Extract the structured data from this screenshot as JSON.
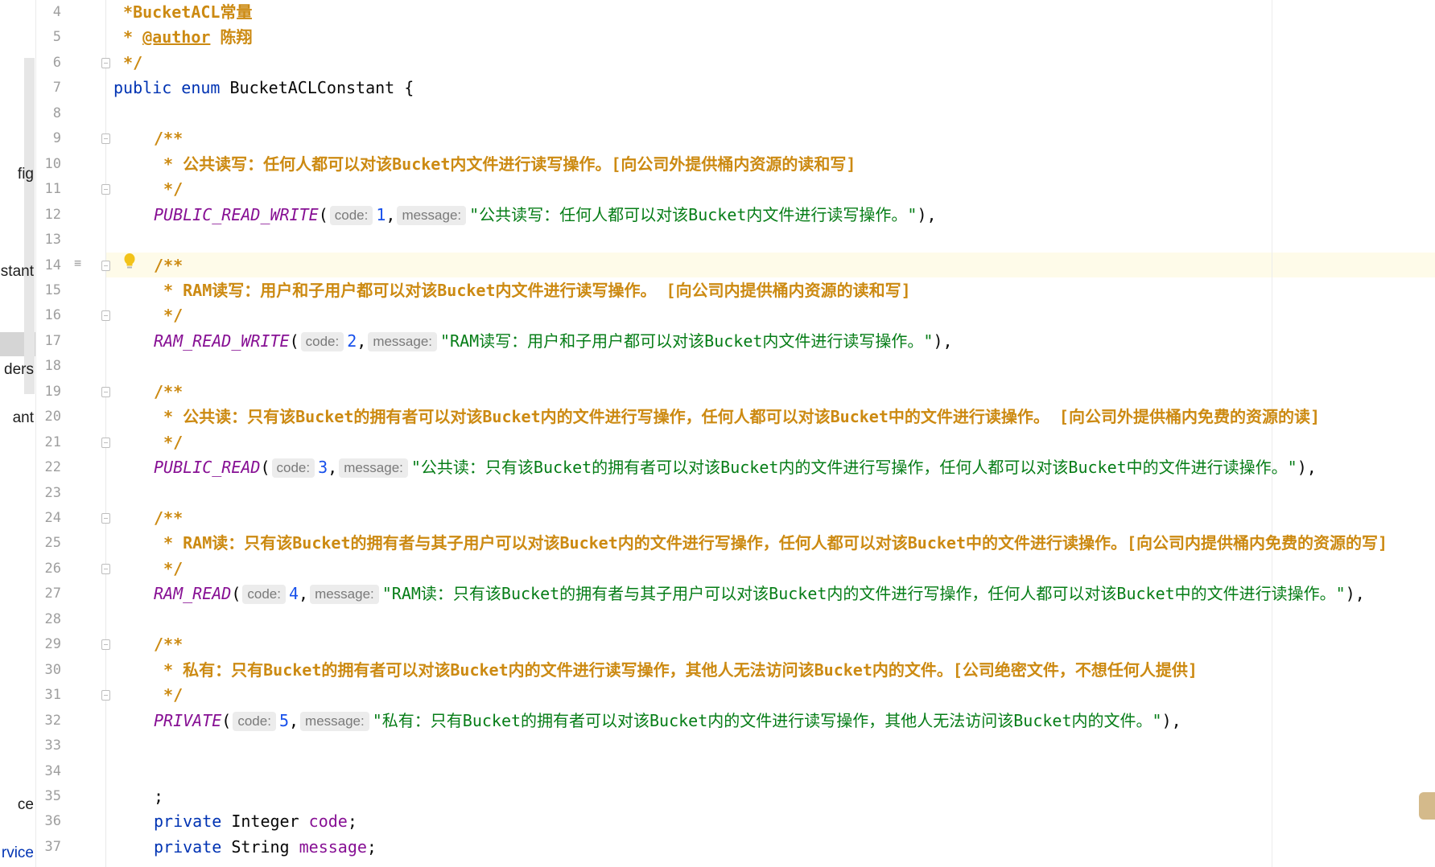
{
  "project_tree": {
    "items": [
      "fig",
      "stant",
      "",
      "ders",
      "ant",
      "ce",
      "rvice"
    ]
  },
  "editor": {
    "line_numbers": [
      "4",
      "5",
      "6",
      "7",
      "8",
      "9",
      "10",
      "11",
      "12",
      "13",
      "14",
      "15",
      "16",
      "17",
      "18",
      "19",
      "20",
      "21",
      "22",
      "23",
      "24",
      "25",
      "26",
      "27",
      "28",
      "29",
      "30",
      "31",
      "32",
      "33",
      "34",
      "35",
      "36",
      "37"
    ],
    "current_line": "14",
    "line4_text": " *BucketACL常量",
    "line5_prefix": " * ",
    "line5_tag": "@author",
    "line5_name": " 陈翔",
    "line6_text": " */",
    "line7": {
      "kw1": "public",
      "kw2": "enum",
      "name": "BucketACLConstant {"
    },
    "doc_open": "/**",
    "doc_close": " */",
    "constants": [
      {
        "comment": " * 公共读写：任何人都可以对该Bucket内文件进行读写操作。[向公司外提供桶内资源的读和写]",
        "name": "PUBLIC_READ_WRITE",
        "code": "1",
        "message": "\"公共读写：任何人都可以对该Bucket内文件进行读写操作。\"",
        "suffix": "),"
      },
      {
        "comment": " * RAM读写：用户和子用户都可以对该Bucket内文件进行读写操作。 [向公司内提供桶内资源的读和写]",
        "name": "RAM_READ_WRITE",
        "code": "2",
        "message": "\"RAM读写：用户和子用户都可以对该Bucket内文件进行读写操作。\"",
        "suffix": "),"
      },
      {
        "comment": " * 公共读：只有该Bucket的拥有者可以对该Bucket内的文件进行写操作，任何人都可以对该Bucket中的文件进行读操作。 [向公司外提供桶内免费的资源的读]",
        "name": "PUBLIC_READ",
        "code": "3",
        "message": "\"公共读：只有该Bucket的拥有者可以对该Bucket内的文件进行写操作，任何人都可以对该Bucket中的文件进行读操作。\"",
        "suffix": "),"
      },
      {
        "comment": " * RAM读：只有该Bucket的拥有者与其子用户可以对该Bucket内的文件进行写操作，任何人都可以对该Bucket中的文件进行读操作。[向公司内提供桶内免费的资源的写]",
        "name": "RAM_READ",
        "code": "4",
        "message": "\"RAM读：只有该Bucket的拥有者与其子用户可以对该Bucket内的文件进行写操作，任何人都可以对该Bucket中的文件进行读操作。\"",
        "suffix": "),"
      },
      {
        "comment": " * 私有：只有Bucket的拥有者可以对该Bucket内的文件进行读写操作，其他人无法访问该Bucket内的文件。[公司绝密文件，不想任何人提供]",
        "name": "PRIVATE",
        "code": "5",
        "message": "\"私有：只有Bucket的拥有者可以对该Bucket内的文件进行读写操作，其他人无法访问该Bucket内的文件。\"",
        "suffix": "),"
      }
    ],
    "hint_code": "code:",
    "hint_message": "message:",
    "paren_open": "(",
    "comma": ",",
    "line35": ";",
    "line36": {
      "kw": "private",
      "type": " Integer ",
      "field": "code",
      "end": ";"
    },
    "line37": {
      "kw": "private",
      "type": " String ",
      "field": "message",
      "end": ";"
    }
  },
  "icons": [
    "fold-marker",
    "render-doc-icon",
    "lightbulb-icon",
    "ai-assistant-icon"
  ]
}
